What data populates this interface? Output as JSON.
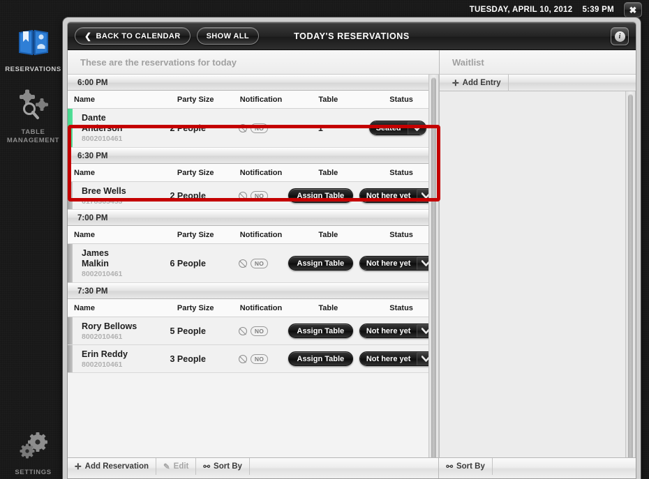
{
  "topbar": {
    "date": "TUESDAY, APRIL 10, 2012",
    "time": "5:39 PM",
    "close_label": "✖",
    "close_icon": "close-icon"
  },
  "rail": {
    "items": [
      {
        "label": "RESERVATIONS",
        "icon": "book-reservations-icon",
        "active": true
      },
      {
        "label": "TABLE\nMANAGEMENT",
        "label_line1": "TABLE",
        "label_line2": "MANAGEMENT",
        "icon": "table-management-icon",
        "active": false
      },
      {
        "label": "SETTINGS",
        "icon": "gears-settings-icon",
        "active": false
      }
    ]
  },
  "appbar": {
    "back_label": "BACK TO CALENDAR",
    "back_chevron": "❮",
    "show_all_label": "SHOW ALL",
    "title": "TODAY'S RESERVATIONS",
    "info_glyph": "i",
    "info_icon": "info-icon"
  },
  "left_pane": {
    "subtitle": "These are the reservations for today",
    "columns": [
      "Name",
      "Party Size",
      "Notification",
      "Table",
      "Status"
    ],
    "groups": [
      {
        "time": "6:00 PM",
        "rows": [
          {
            "name_line1": "Dante",
            "name_line2": "Anderson",
            "phone": "8002010461",
            "party": "2 People",
            "notification": "NO",
            "notification_icon": "no-notification-icon",
            "table": "1",
            "has_assign_button": false,
            "status": "Seated",
            "accent": "green",
            "highlighted": true
          }
        ]
      },
      {
        "time": "6:30 PM",
        "rows": [
          {
            "name_line1": "Bree Wells",
            "name_line2": "",
            "phone": "6178365453",
            "party": "2 People",
            "notification": "NO",
            "notification_icon": "no-notification-icon",
            "table": "Assign Table",
            "has_assign_button": true,
            "status": "Not here yet",
            "accent": "gray",
            "highlighted": false
          }
        ]
      },
      {
        "time": "7:00 PM",
        "rows": [
          {
            "name_line1": "James",
            "name_line2": "Malkin",
            "phone": "8002010461",
            "party": "6 People",
            "notification": "NO",
            "notification_icon": "no-notification-icon",
            "table": "Assign Table",
            "has_assign_button": true,
            "status": "Not here yet",
            "accent": "gray",
            "highlighted": false
          }
        ]
      },
      {
        "time": "7:30 PM",
        "rows": [
          {
            "name_line1": "Rory Bellows",
            "name_line2": "",
            "phone": "8002010461",
            "party": "5 People",
            "notification": "NO",
            "notification_icon": "no-notification-icon",
            "table": "Assign Table",
            "has_assign_button": true,
            "status": "Not here yet",
            "accent": "gray",
            "highlighted": false
          },
          {
            "name_line1": "Erin Reddy",
            "name_line2": "",
            "phone": "8002010461",
            "party": "3 People",
            "notification": "NO",
            "notification_icon": "no-notification-icon",
            "table": "Assign Table",
            "has_assign_button": true,
            "status": "Not here yet",
            "accent": "gray",
            "highlighted": false
          }
        ]
      }
    ],
    "dropdown_arrow": "❱"
  },
  "right_pane": {
    "subtitle": "Waitlist",
    "add_entry_label": "Add Entry",
    "add_entry_plus": "✛",
    "entries": []
  },
  "bottombar": {
    "left": [
      {
        "label": "Add Reservation",
        "glyph": "✛",
        "icon": "plus-icon",
        "dim": false
      },
      {
        "label": "Edit",
        "glyph": "✎",
        "icon": "pencil-icon",
        "dim": true
      },
      {
        "label": "Sort By",
        "glyph": "⚯",
        "icon": "sort-icon",
        "dim": false
      }
    ],
    "right": [
      {
        "label": "Sort By",
        "glyph": "⚯",
        "icon": "sort-icon",
        "dim": false
      }
    ]
  },
  "colors": {
    "accent_green": "#46d38a",
    "accent_gray": "#9d9d9d",
    "highlight_red": "#c40000",
    "rail_icon_blue": "#2f7fd6"
  }
}
